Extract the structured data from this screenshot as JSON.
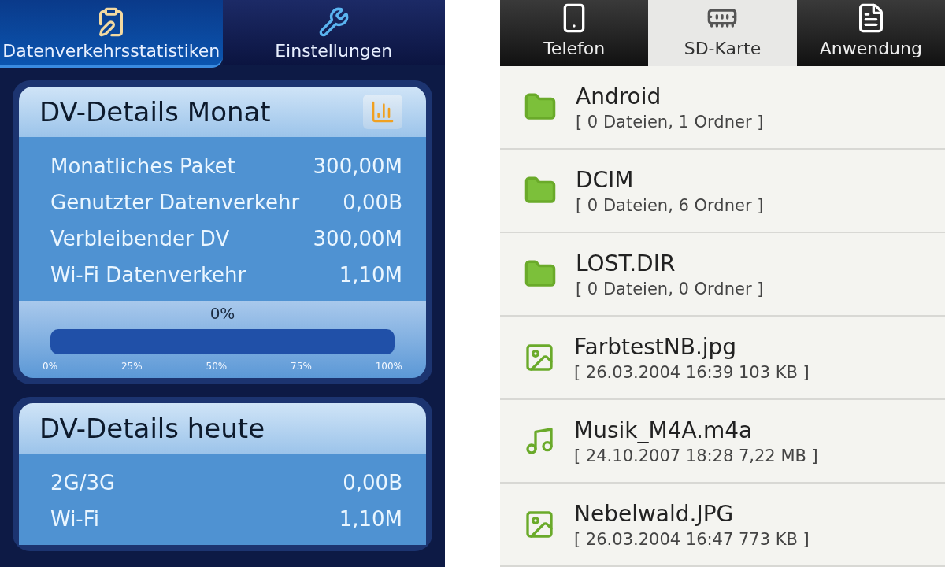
{
  "traffic_app": {
    "tabs": [
      {
        "label": "Datenverkehrsstatistiken",
        "selected": true
      },
      {
        "label": "Einstellungen",
        "selected": false
      }
    ],
    "cards": [
      {
        "title": "DV-Details Monat",
        "rows": [
          {
            "label": "Monatliches Paket",
            "value": "300,00M"
          },
          {
            "label": "Genutzter Datenverkehr",
            "value": "0,00B"
          },
          {
            "label": "Verbleibender DV",
            "value": "300,00M"
          },
          {
            "label": "Wi-Fi Datenverkehr",
            "value": "1,10M"
          }
        ],
        "progress": {
          "reading": "0%",
          "level": 0,
          "ticks": [
            "0%",
            "25%",
            "50%",
            "75%",
            "100%"
          ]
        }
      },
      {
        "title": "DV-Details heute",
        "rows": [
          {
            "label": "2G/3G",
            "value": "0,00B"
          },
          {
            "label": "Wi-Fi",
            "value": "1,10M"
          }
        ]
      }
    ]
  },
  "file_manager": {
    "tabs": [
      {
        "label": "Telefon",
        "selected": false
      },
      {
        "label": "SD-Karte",
        "selected": true
      },
      {
        "label": "Anwendung",
        "selected": false
      }
    ],
    "items": [
      {
        "kind": "folder",
        "name": "Android",
        "details": "[ 0 Dateien, 1 Ordner ]"
      },
      {
        "kind": "folder",
        "name": "DCIM",
        "details": "[ 0 Dateien, 6 Ordner ]"
      },
      {
        "kind": "folder",
        "name": "LOST.DIR",
        "details": "[ 0 Dateien, 0 Ordner ]"
      },
      {
        "kind": "image",
        "name": "FarbtestNB.jpg",
        "details": "[ 26.03.2004 16:39 103 KB ]"
      },
      {
        "kind": "audio",
        "name": "Musik_M4A.m4a",
        "details": "[ 24.10.2007 18:28 7,22 MB ]"
      },
      {
        "kind": "image",
        "name": "Nebelwald.JPG",
        "details": "[ 26.03.2004 16:47 773 KB ]"
      }
    ]
  }
}
